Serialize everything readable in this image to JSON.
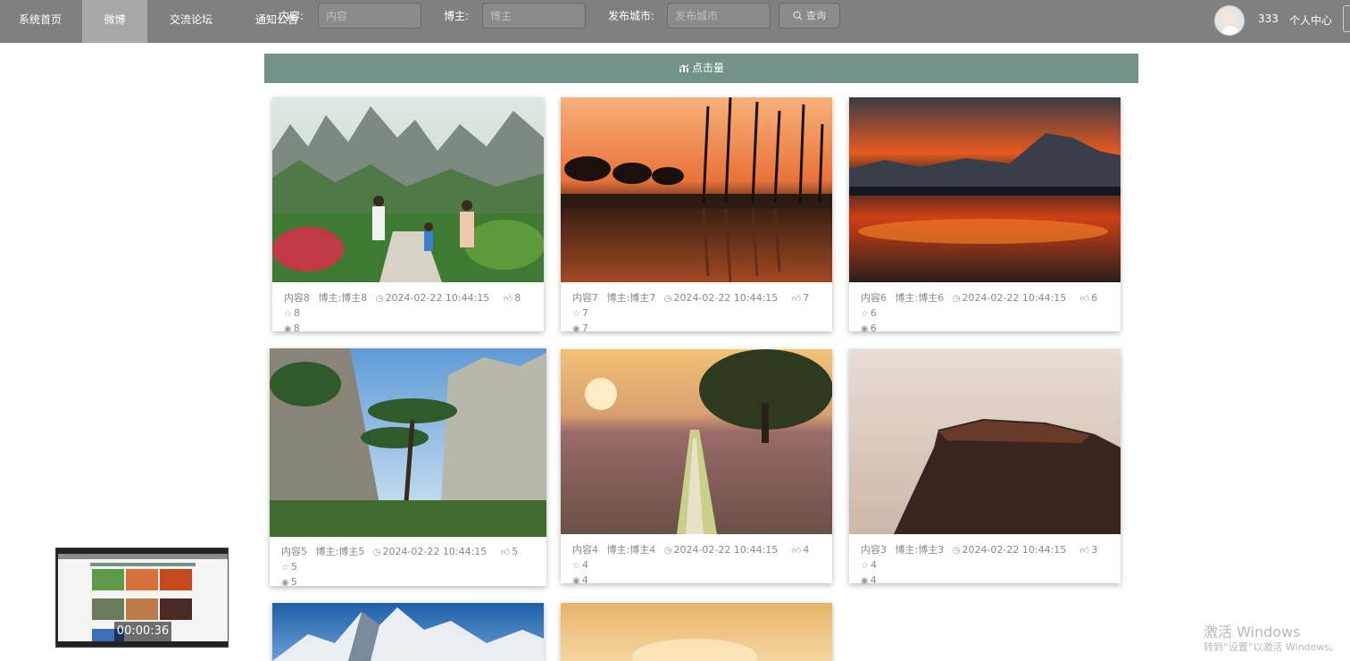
{
  "nav": {
    "items": [
      {
        "label": "系统首页",
        "active": false
      },
      {
        "label": "微博",
        "active": true
      },
      {
        "label": "交流论坛",
        "active": false
      },
      {
        "label": "通知公告",
        "active": false
      }
    ]
  },
  "search": {
    "content_label": "内容:",
    "content_placeholder": "内容",
    "blogger_label": "博主:",
    "blogger_placeholder": "博主",
    "city_label": "发布城市:",
    "city_placeholder": "发布城市",
    "query_label": "查询"
  },
  "user": {
    "name": "333",
    "center_label": "个人中心"
  },
  "sort_bar": {
    "label": "点击量"
  },
  "cards": [
    {
      "content": "内容8",
      "blogger": "博主:博主8",
      "time": "2024-02-22 10:44:15",
      "likes": "8",
      "favorites": "8",
      "views": "8"
    },
    {
      "content": "内容7",
      "blogger": "博主:博主7",
      "time": "2024-02-22 10:44:15",
      "likes": "7",
      "favorites": "7",
      "views": "7"
    },
    {
      "content": "内容6",
      "blogger": "博主:博主6",
      "time": "2024-02-22 10:44:15",
      "likes": "6",
      "favorites": "6",
      "views": "6"
    },
    {
      "content": "内容5",
      "blogger": "博主:博主5",
      "time": "2024-02-22 10:44:15",
      "likes": "5",
      "favorites": "5",
      "views": "5"
    },
    {
      "content": "内容4",
      "blogger": "博主:博主4",
      "time": "2024-02-22 10:44:15",
      "likes": "4",
      "favorites": "4",
      "views": "4"
    },
    {
      "content": "内容3",
      "blogger": "博主:博主3",
      "time": "2024-02-22 10:44:15",
      "likes": "3",
      "favorites": "4",
      "views": "4"
    }
  ],
  "video": {
    "time": "00:00:36"
  },
  "watermark": {
    "line1": "激活 Windows",
    "line2": "转到“设置”以激活 Windows。"
  },
  "colors": {
    "nav_bg": "#808080",
    "nav_active": "#a8a8a8",
    "sort_bar": "#72928a"
  }
}
